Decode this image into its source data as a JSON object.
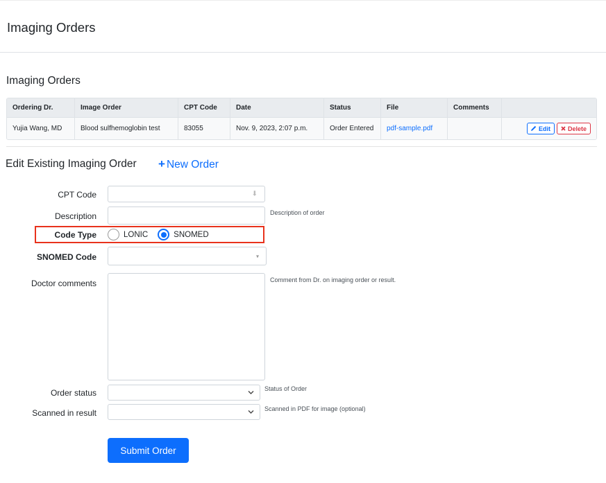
{
  "header": {
    "title": "Imaging Orders"
  },
  "orders_section": {
    "title": "Imaging Orders"
  },
  "table": {
    "columns": [
      "Ordering Dr.",
      "Image Order",
      "CPT Code",
      "Date",
      "Status",
      "File",
      "Comments",
      ""
    ],
    "rows": [
      {
        "ordering_dr": "Yujia Wang, MD",
        "image_order": "Blood sulfhemoglobin test",
        "cpt_code": "83055",
        "date": "Nov. 9, 2023, 2:07 p.m.",
        "status": "Order Entered",
        "file": "pdf-sample.pdf",
        "comments": "",
        "edit_label": "Edit",
        "delete_label": "Delete"
      }
    ]
  },
  "edit_form": {
    "title": "Edit Existing Imaging Order",
    "new_order_label": "New Order",
    "cpt_code": {
      "label": "CPT Code",
      "value": ""
    },
    "description": {
      "label": "Description",
      "value": "",
      "hint": "Description of order"
    },
    "code_type": {
      "label": "Code Type",
      "options": [
        "LONIC",
        "SNOMED"
      ],
      "selected": "SNOMED"
    },
    "snomed_code": {
      "label": "SNOMED Code",
      "value": ""
    },
    "doctor_comments": {
      "label": "Doctor comments",
      "value": "",
      "hint": "Comment from Dr. on imaging order or result."
    },
    "order_status": {
      "label": "Order status",
      "value": "",
      "hint": "Status of Order"
    },
    "scanned_result": {
      "label": "Scanned in result",
      "value": "",
      "hint": "Scanned in PDF for image (optional)"
    },
    "submit_label": "Submit Order"
  },
  "colors": {
    "primary": "#0d6efd",
    "danger": "#dc3545",
    "highlight": "#e8321c"
  }
}
